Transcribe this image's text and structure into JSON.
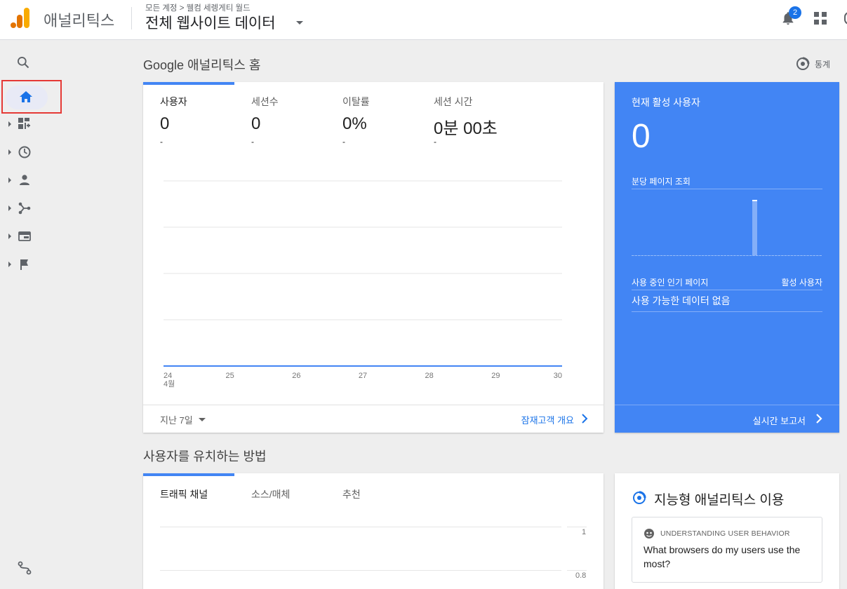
{
  "header": {
    "app_name": "애널리틱스",
    "breadcrumb": "모든 계정 > 웰컴 세렝게티 월드",
    "view_name": "전체 웹사이트 데이터",
    "notification_count": "2"
  },
  "sidenav": {
    "items": [
      "search-icon",
      "home-icon",
      "customization-icon",
      "realtime-icon",
      "audience-icon",
      "acquisition-icon",
      "behavior-icon",
      "conversions-icon"
    ],
    "bottom": "discover-icon"
  },
  "home": {
    "section_title": "Google 애널리틱스 홈",
    "insights_label": "통계",
    "metrics": [
      {
        "label": "사용자",
        "value": "0",
        "delta": "-"
      },
      {
        "label": "세션수",
        "value": "0",
        "delta": "-"
      },
      {
        "label": "이탈률",
        "value": "0%",
        "delta": "-"
      },
      {
        "label": "세션 시간",
        "value": "0분 00초",
        "delta": "-"
      }
    ],
    "range_label": "지난 7일",
    "audience_link": "잠재고객 개요"
  },
  "chart_data": {
    "type": "line",
    "categories": [
      "24",
      "25",
      "26",
      "27",
      "28",
      "29",
      "30"
    ],
    "month_label": "4월",
    "series": [
      {
        "values": [
          0,
          0,
          0,
          0,
          0,
          0,
          0
        ]
      }
    ]
  },
  "realtime": {
    "title": "현재 활성 사용자",
    "count": "0",
    "pageviews_label": "분당 페이지 조회",
    "top_pages_label": "사용 중인 인기 페이지",
    "active_users_label": "활성 사용자",
    "no_data": "사용 가능한 데이터 없음",
    "report_link": "실시간 보고서",
    "pageview_bars": [
      0,
      0,
      0,
      0,
      0,
      0,
      0,
      0,
      0,
      0,
      0,
      0,
      0,
      0,
      0,
      0,
      0,
      0,
      0,
      0,
      0,
      0,
      0,
      0,
      0,
      0,
      0,
      0,
      0,
      0,
      0,
      0,
      0,
      0,
      0,
      0,
      0,
      0,
      0,
      0,
      0,
      0,
      0,
      0,
      0,
      0,
      0,
      0,
      0,
      0,
      0,
      0,
      0,
      0,
      0,
      0,
      0,
      0,
      0,
      0
    ]
  },
  "retention": {
    "section_title": "사용자를 유치하는 방법",
    "tabs": [
      "트래픽 채널",
      "소스/매체",
      "추천"
    ],
    "y_ticks": [
      "1",
      "0.8"
    ]
  },
  "intelligence": {
    "title": "지능형 애널리틱스 이용",
    "question_category": "UNDERSTANDING USER BEHAVIOR",
    "question_text": "What browsers do my users use the most?"
  },
  "colors": {
    "accent": "#4285f4",
    "link": "#1a73e8",
    "highlight_box": "#e53935",
    "logo_orange": "#f9ab00",
    "logo_dark_orange": "#e37400"
  }
}
